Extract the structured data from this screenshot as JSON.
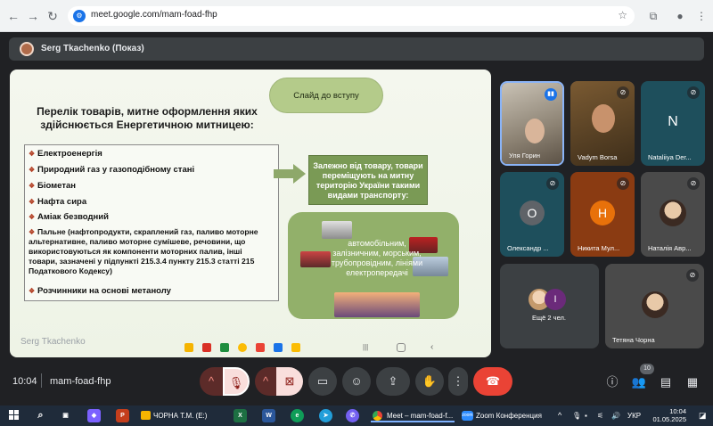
{
  "browser": {
    "url": "meet.google.com/mam-foad-fhp"
  },
  "presenter": {
    "name": "Serg Tkachenko (Показ)"
  },
  "slide": {
    "pill": "Слайд до вступу",
    "title": "Перелік товарів, митне оформлення яких здійснюється Енергетичною митницею:",
    "items": [
      "Електроенергія",
      "Природний газ у газоподібному стані",
      "Біометан",
      "Нафта сира",
      "Аміак безводний",
      "Пальне (нафтопродукти, скраплений газ, паливо моторне альтернативне, паливо моторне сумішеве, речовини, що використовуються як компоненти моторних палив, інші товари, зазначені у підпункті 215.3.4 пункту 215.3 статті 215 Податкового Кодексу)",
      "Розчинники на основі метанолу"
    ],
    "info": "Залежно від товару, товари переміщують на митну територію України такими видами транспорту:",
    "transport": "автомобільним, залізничним, морським, трубопровідним, лініями електропередачі",
    "logo": "Serg Tkachenko"
  },
  "participants": [
    {
      "name": "Уля Горин",
      "letter": "",
      "color": ""
    },
    {
      "name": "Vadym Borsa",
      "letter": "",
      "color": ""
    },
    {
      "name": "Nataliiya Der...",
      "letter": "N",
      "color": "#1e4f5c"
    },
    {
      "name": "Олександр ...",
      "letter": "O",
      "color": "#5f6368"
    },
    {
      "name": "Никита Мул...",
      "letter": "H",
      "color": "#e8710a"
    },
    {
      "name": "Наталія Авр...",
      "letter": "",
      "color": ""
    },
    {
      "name": "Ещё 2 чел.",
      "letter": "I",
      "color": "#6b2a7a"
    },
    {
      "name": "Тетяна Чорна",
      "letter": "",
      "color": ""
    }
  ],
  "meeting": {
    "time": "10:04",
    "code": "mam-foad-fhp",
    "people_count": "10"
  },
  "taskbar": {
    "app1": "ЧОРНА Т.М. (E:)",
    "app2": "Meet – mam-foad-f...",
    "app3": "Zoom Конференция",
    "lang": "УКР",
    "time": "10:04",
    "date": "01.05.2025"
  }
}
